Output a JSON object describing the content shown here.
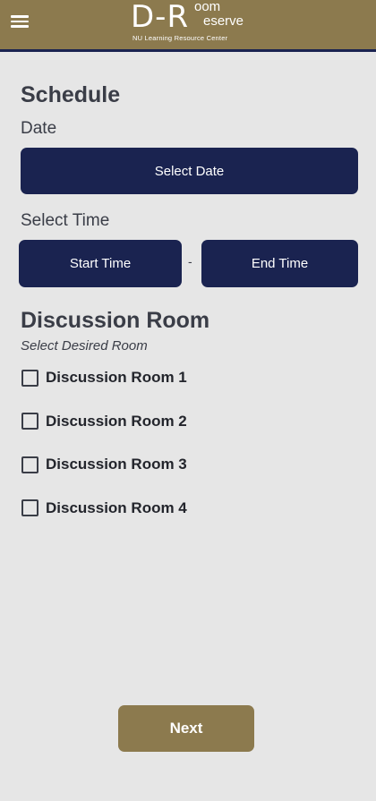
{
  "header": {
    "menu_icon": "hamburger-menu-icon",
    "logo": {
      "dr": "D-R",
      "oom": "oom",
      "eserve": "eserve",
      "subtitle": "NU Learning Resource Center"
    },
    "colors": {
      "header_bg": "#8c7a4e",
      "navy": "#1a2350"
    }
  },
  "schedule": {
    "heading": "Schedule",
    "date_label": "Date",
    "select_date_label": "Select Date",
    "time_label": "Select Time",
    "start_time_label": "Start Time",
    "separator": "-",
    "end_time_label": "End Time"
  },
  "rooms": {
    "heading": "Discussion Room",
    "subheading": "Select Desired Room",
    "items": [
      {
        "label": "Discussion Room 1",
        "checked": false
      },
      {
        "label": "Discussion Room 2",
        "checked": false
      },
      {
        "label": "Discussion Room 3",
        "checked": false
      },
      {
        "label": "Discussion Room 4",
        "checked": false
      }
    ]
  },
  "footer": {
    "next_label": "Next"
  }
}
